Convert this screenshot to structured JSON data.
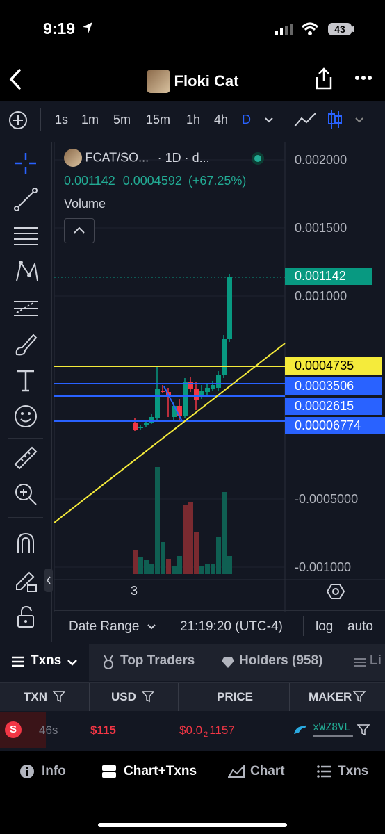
{
  "status": {
    "time": "9:19",
    "battery": "43"
  },
  "nav": {
    "title": "Floki Cat"
  },
  "timeframes": [
    "1s",
    "1m",
    "5m",
    "15m",
    "1h",
    "4h",
    "D"
  ],
  "active_timeframe": "D",
  "chart": {
    "symbol": "FCAT/SO...",
    "interval": "· 1D · d...",
    "ohlc_price": "0.001142",
    "change_abs": "0.0004592",
    "change_pct": "(+67.25%)",
    "volume_label": "Volume",
    "y_ticks": [
      "0.002000",
      "0.001500",
      "0.001000",
      "-0.0005000",
      "-0.001000"
    ],
    "price_tags": [
      {
        "label": "0.001142",
        "color": "#089981"
      },
      {
        "label": "0.0004735",
        "color": "#f5eb3b"
      },
      {
        "label": "0.0003506",
        "color": "#2962ff"
      },
      {
        "label": "0.0002615",
        "color": "#2962ff"
      },
      {
        "label": "0.00006774",
        "color": "#2962ff"
      }
    ],
    "x_label": "3",
    "date_range": "Date Range",
    "clock": "21:19:20 (UTC-4)",
    "log": "log",
    "auto": "auto"
  },
  "tabs": [
    {
      "label": "Txns",
      "active": true
    },
    {
      "label": "Top Traders"
    },
    {
      "label": "Holders (958)"
    },
    {
      "label": "Li"
    }
  ],
  "table": {
    "headers": [
      "TXN",
      "USD",
      "PRICE",
      "MAKER"
    ],
    "rows": [
      {
        "type": "S",
        "age": "46s",
        "usd": "$115",
        "price_prefix": "$0.0",
        "price_sub": "2",
        "price_rest": "1157",
        "maker": "xWZ8VL"
      }
    ]
  },
  "bottom_nav": [
    {
      "label": "Info",
      "icon": "info-icon"
    },
    {
      "label": "Chart+Txns",
      "icon": "chart-txns-icon",
      "active": true
    },
    {
      "label": "Chart",
      "icon": "area-chart-icon"
    },
    {
      "label": "Txns",
      "icon": "list-icon"
    }
  ],
  "colors": {
    "up": "#089981",
    "down": "#f23645",
    "yellow": "#f5eb3b",
    "blue": "#2962ff"
  }
}
